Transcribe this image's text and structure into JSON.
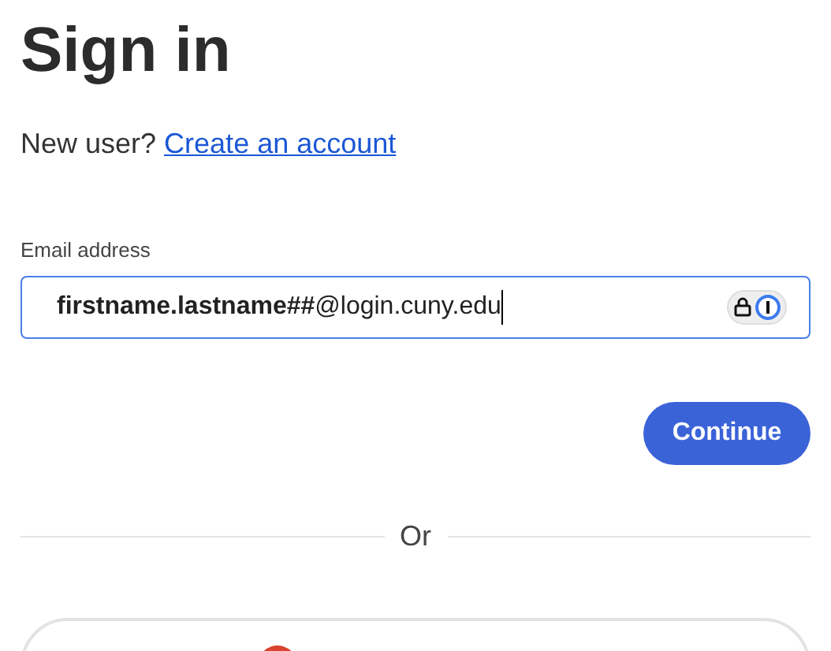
{
  "title": "Sign in",
  "signup": {
    "prompt": "New user?",
    "link": "Create an account"
  },
  "email": {
    "label": "Email address",
    "value": "**firstname.lastname##**@login.cuny.edu",
    "focused": true
  },
  "continue_button": "Continue",
  "divider": "Or"
}
